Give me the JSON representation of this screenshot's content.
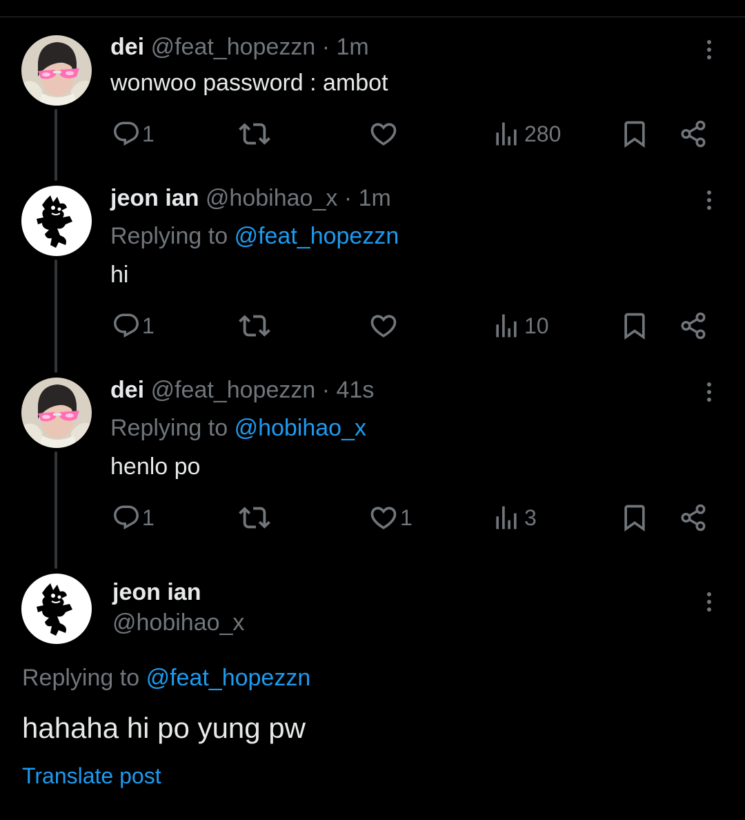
{
  "colors": {
    "background": "#000000",
    "text": "#e7e9ea",
    "muted": "#71767b",
    "link": "#1d9bf0",
    "thread_line": "#333639"
  },
  "tweets": [
    {
      "name": "dei",
      "handle": "@feat_hopezzn",
      "dot": "·",
      "time": "1m",
      "body": "wonwoo password : ambot",
      "reply_count": "1",
      "like_count": "",
      "views": "280",
      "avatar": "dei-avatar"
    },
    {
      "name": "jeon ian",
      "handle": "@hobihao_x",
      "dot": "·",
      "time": "1m",
      "replying_to_label": "Replying to",
      "replying_to_handle": "@feat_hopezzn",
      "body": "hi",
      "reply_count": "1",
      "like_count": "",
      "views": "10",
      "avatar": "jeon-ian-avatar"
    },
    {
      "name": "dei",
      "handle": "@feat_hopezzn",
      "dot": "·",
      "time": "41s",
      "replying_to_label": "Replying to",
      "replying_to_handle": "@hobihao_x",
      "body": "henlo po",
      "reply_count": "1",
      "like_count": "1",
      "views": "3",
      "avatar": "dei-avatar"
    }
  ],
  "main_tweet": {
    "name": "jeon ian",
    "handle": "@hobihao_x",
    "replying_to_label": "Replying to",
    "replying_to_handle": "@feat_hopezzn",
    "body": "hahaha hi po yung pw",
    "translate_label": "Translate post",
    "avatar": "jeon-ian-avatar"
  },
  "icons": [
    "reply-icon",
    "retweet-icon",
    "like-icon",
    "views-icon",
    "bookmark-icon",
    "share-icon",
    "more-icon"
  ]
}
